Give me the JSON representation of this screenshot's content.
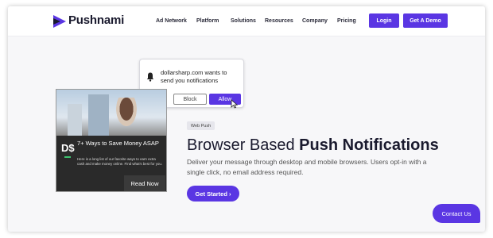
{
  "nav": {
    "logo_text": "Pushnami",
    "links": [
      "Ad Network",
      "Platform",
      "Solutions",
      "Resources",
      "Company",
      "Pricing"
    ],
    "login_label": "Login",
    "demo_label": "Get A Demo"
  },
  "notification": {
    "message": "dollarsharp.com wants to send you notifications",
    "block_label": "Block",
    "allow_label": "Allow"
  },
  "ad_card": {
    "logo_text": "D$",
    "title": "7+ Ways to Save Money ASAP",
    "description": "Here is a long list of our favorite ways to earn extra cash and make money online. Find what's best for you.",
    "cta_label": "Read Now"
  },
  "hero": {
    "badge": "Web Push",
    "headline_plain": "Browser Based ",
    "headline_bold": "Push Notifications",
    "description": "Deliver your message through desktop and mobile browsers. Users opt-in with a single click, no email address required.",
    "cta_label": "Get Started ›"
  },
  "contact_label": "Contact Us",
  "colors": {
    "brand": "#5a36e3",
    "text_dark": "#1a1a2e"
  }
}
